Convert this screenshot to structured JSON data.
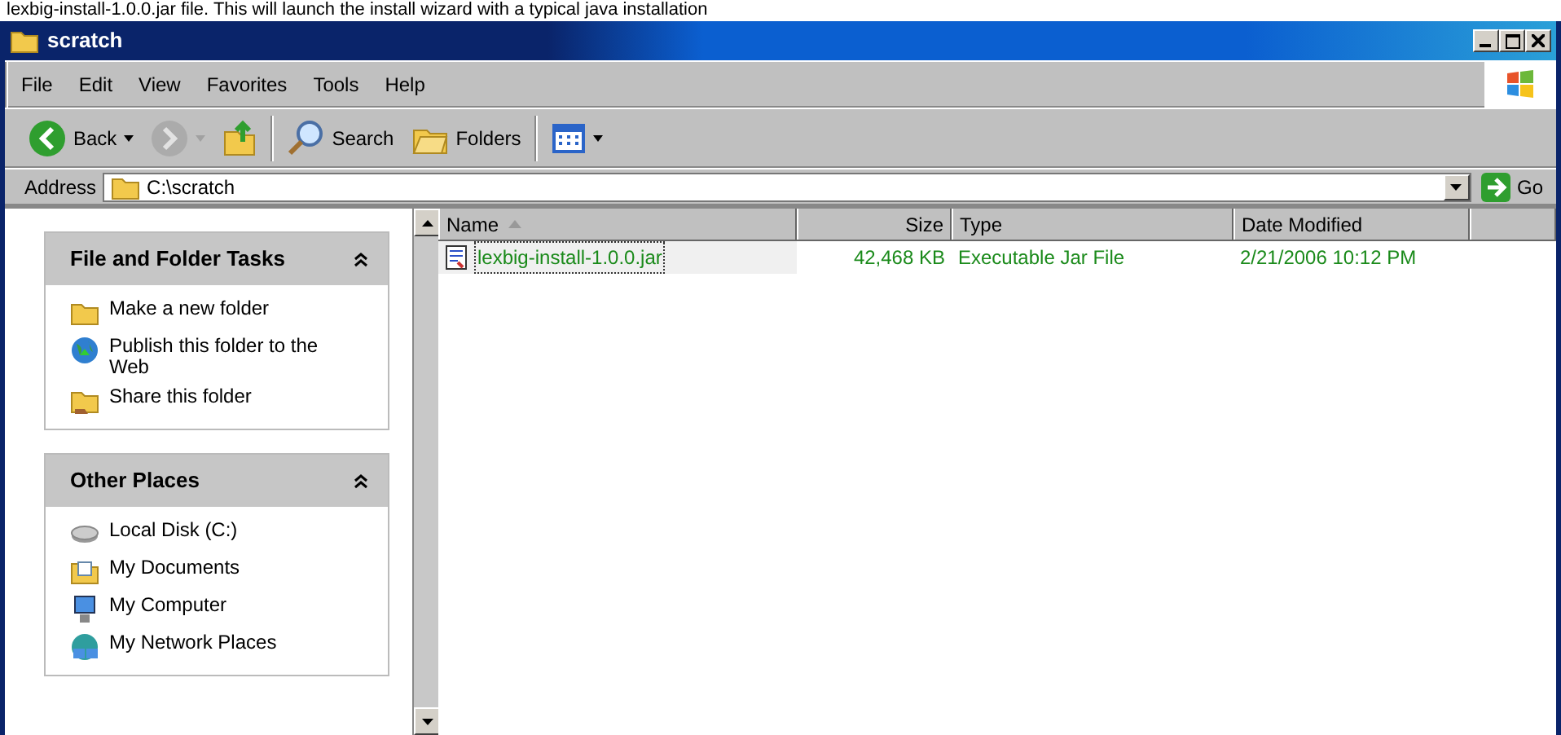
{
  "caption": "lexbig-install-1.0.0.jar file. This will launch the install wizard with a typical java installation",
  "window": {
    "title": "scratch"
  },
  "menu": [
    "File",
    "Edit",
    "View",
    "Favorites",
    "Tools",
    "Help"
  ],
  "toolbar": [
    {
      "kind": "back",
      "label": "Back",
      "disabled": false
    },
    {
      "kind": "forward",
      "disabled": true
    },
    {
      "kind": "up",
      "disabled": false
    },
    {
      "kind": "search",
      "label": "Search",
      "disabled": false
    },
    {
      "kind": "folders",
      "label": "Folders",
      "disabled": false
    },
    {
      "kind": "views",
      "disabled": false
    }
  ],
  "address": {
    "label": "Address",
    "value": "C:\\scratch",
    "go": "Go"
  },
  "task_panels": [
    {
      "title": "File and Folder Tasks",
      "expanded": true,
      "items": [
        {
          "kind": "newfolder",
          "label": "Make a new folder"
        },
        {
          "kind": "publish",
          "label": "Publish this folder to the Web"
        },
        {
          "kind": "share",
          "label": "Share this folder"
        }
      ]
    },
    {
      "title": "Other Places",
      "expanded": true,
      "items": [
        {
          "kind": "disk",
          "label": "Local Disk (C:)"
        },
        {
          "kind": "documents",
          "label": "My Documents"
        },
        {
          "kind": "computer",
          "label": "My Computer"
        },
        {
          "kind": "network",
          "label": "My Network Places"
        }
      ]
    }
  ],
  "table": {
    "columns": [
      {
        "label": "Name",
        "sorted": true
      },
      {
        "label": "Size",
        "sorted": false
      },
      {
        "label": "Type",
        "sorted": false
      },
      {
        "label": "Date Modified",
        "sorted": false
      }
    ],
    "rows": [
      {
        "cells": [
          "lexbig-install-1.0.0.jar",
          "42,468 KB",
          "Executable Jar File",
          "2/21/2006 10:12 PM"
        ],
        "selected": true
      }
    ]
  }
}
